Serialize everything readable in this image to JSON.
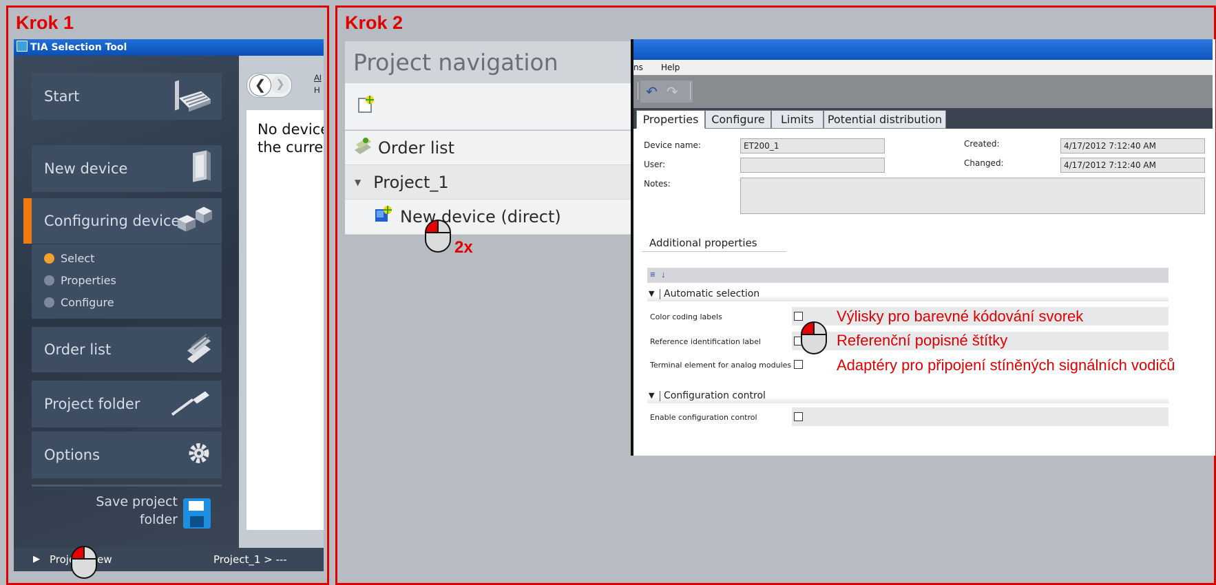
{
  "step1": {
    "label": "Krok 1",
    "window_title": "TIA Selection Tool",
    "nav": {
      "start": "Start",
      "new_device": "New device",
      "configuring_devices": "Configuring devices",
      "sub_items": [
        "Select",
        "Properties",
        "Configure"
      ],
      "order_list": "Order list",
      "project_folder": "Project folder",
      "options": "Options",
      "save_project_line1": "Save project",
      "save_project_line2": "folder"
    },
    "content": {
      "breadcrumb_top": "Al",
      "breadcrumb_bottom": "H",
      "message_line1": "No device",
      "message_line2": "the curre"
    },
    "status": {
      "project_view": "Project view",
      "path": "Project_1 > ---"
    }
  },
  "step2": {
    "label": "Krok 2",
    "project_navigation": {
      "title": "Project navigation",
      "order_list": "Order list",
      "project": "Project_1",
      "new_device": "New device (direct)"
    },
    "double_click_hint": "2x",
    "menu": {
      "partial": "ns",
      "help": "Help"
    },
    "tabs": [
      "Properties",
      "Configure",
      "Limits",
      "Potential distribution"
    ],
    "fields": {
      "device_name_label": "Device name:",
      "device_name_value": "ET200_1",
      "user_label": "User:",
      "user_value": "",
      "notes_label": "Notes:",
      "created_label": "Created:",
      "created_value": "4/17/2012 7:12:40 AM",
      "changed_label": "Changed:",
      "changed_value": "4/17/2012 7:12:40 AM"
    },
    "additional_properties": "Additional properties",
    "sections": {
      "automatic_selection": "Automatic selection",
      "configuration_control": "Configuration control"
    },
    "properties": [
      {
        "label": "Color coding labels",
        "checked": false
      },
      {
        "label": "Reference identification label",
        "checked": false
      },
      {
        "label": "Terminal element for analog modules",
        "checked": false
      }
    ],
    "enable_configuration_control": {
      "label": "Enable configuration control",
      "checked": false
    },
    "notes": [
      "Výlisky pro barevné kódování svorek",
      "Referenční popisné štítky",
      "Adaptéry pro připojení stíněných signálních vodičů"
    ]
  },
  "colors": {
    "frame_red": "#e00000",
    "accent_orange": "#f07a12",
    "tia_dark": "#3d4d62"
  }
}
